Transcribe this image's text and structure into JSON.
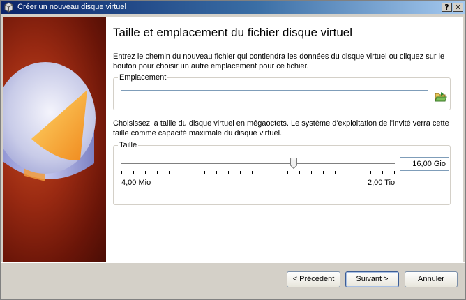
{
  "window": {
    "title": "Créer un nouveau disque virtuel",
    "help_button": "?",
    "close_button": "✕"
  },
  "page": {
    "heading": "Taille et emplacement du fichier disque virtuel",
    "location_description": "Entrez le chemin du nouveau fichier qui contiendra les données du disque virtuel ou cliquez sur le bouton pour choisir un autre emplacement pour ce fichier.",
    "location_group_label": "Emplacement",
    "location_value": "",
    "size_description": "Choisissez la taille du disque virtuel en mégaoctets. Le système d'exploitation de l'invité verra cette taille comme capacité maximale du disque virtuel.",
    "size_group_label": "Taille",
    "size_value": "16,00 Gio",
    "slider_min_label": "4,00 Mio",
    "slider_max_label": "2,00 Tio",
    "slider_position_fraction": 0.63,
    "tick_count": 24
  },
  "buttons": {
    "back": "< Précédent",
    "next": "Suivant >",
    "cancel": "Annuler"
  },
  "icons": {
    "title_icon": "virtualbox-icon",
    "folder_icon": "folder-open-icon",
    "sidebar_art": "disk-pie-illustration"
  }
}
